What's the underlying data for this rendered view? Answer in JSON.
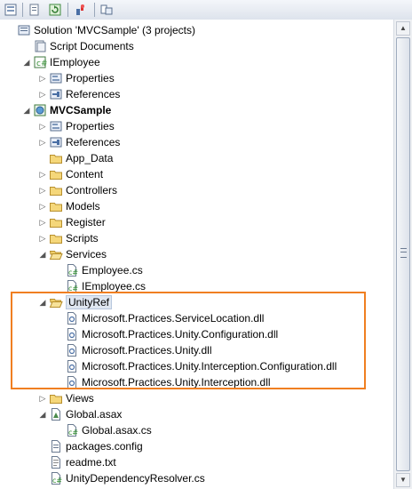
{
  "toolbar": {
    "buttons": [
      {
        "icon": "show-all-files-icon"
      },
      {
        "icon": "properties-icon"
      },
      {
        "icon": "refresh-icon"
      },
      {
        "icon": "view-code-icon"
      },
      {
        "icon": "class-view-icon"
      }
    ]
  },
  "tree": [
    {
      "label": "Solution 'MVCSample' (3 projects)",
      "icon": "solution-icon"
    },
    {
      "label": "Script Documents",
      "icon": "script-documents-icon"
    },
    {
      "label": "IEmployee",
      "icon": "project-icon",
      "expander": "expanded"
    },
    {
      "label": "Properties",
      "icon": "properties-folder-icon",
      "expander": "collapsed"
    },
    {
      "label": "References",
      "icon": "references-icon",
      "expander": "collapsed"
    },
    {
      "label": "MVCSample",
      "icon": "web-project-icon",
      "expander": "expanded",
      "bold": true
    },
    {
      "label": "Properties",
      "icon": "properties-folder-icon",
      "expander": "collapsed"
    },
    {
      "label": "References",
      "icon": "references-icon",
      "expander": "collapsed"
    },
    {
      "label": "App_Data",
      "icon": "folder-icon"
    },
    {
      "label": "Content",
      "icon": "folder-icon",
      "expander": "collapsed"
    },
    {
      "label": "Controllers",
      "icon": "folder-icon",
      "expander": "collapsed"
    },
    {
      "label": "Models",
      "icon": "folder-icon",
      "expander": "collapsed"
    },
    {
      "label": "Register",
      "icon": "folder-icon",
      "expander": "collapsed"
    },
    {
      "label": "Scripts",
      "icon": "folder-icon",
      "expander": "collapsed"
    },
    {
      "label": "Services",
      "icon": "folder-open-icon",
      "expander": "expanded"
    },
    {
      "label": "Employee.cs",
      "icon": "cs-file-icon"
    },
    {
      "label": "IEmployee.cs",
      "icon": "cs-file-icon"
    },
    {
      "label": "UnityRef",
      "icon": "folder-open-icon",
      "expander": "expanded",
      "selected": true
    },
    {
      "label": "Microsoft.Practices.ServiceLocation.dll",
      "icon": "dll-file-icon"
    },
    {
      "label": "Microsoft.Practices.Unity.Configuration.dll",
      "icon": "dll-file-icon"
    },
    {
      "label": "Microsoft.Practices.Unity.dll",
      "icon": "dll-file-icon"
    },
    {
      "label": "Microsoft.Practices.Unity.Interception.Configuration.dll",
      "icon": "dll-file-icon"
    },
    {
      "label": "Microsoft.Practices.Unity.Interception.dll",
      "icon": "dll-file-icon"
    },
    {
      "label": "Views",
      "icon": "folder-icon",
      "expander": "collapsed"
    },
    {
      "label": "Global.asax",
      "icon": "asax-file-icon",
      "expander": "expanded"
    },
    {
      "label": "Global.asax.cs",
      "icon": "cs-file-icon"
    },
    {
      "label": "packages.config",
      "icon": "config-file-icon"
    },
    {
      "label": "readme.txt",
      "icon": "text-file-icon"
    },
    {
      "label": "UnityDependencyResolver.cs",
      "icon": "cs-file-icon"
    }
  ],
  "colors": {
    "highlight_border": "#f07f21",
    "folder": "#f5d77a",
    "selection": "#dfe6f0"
  }
}
